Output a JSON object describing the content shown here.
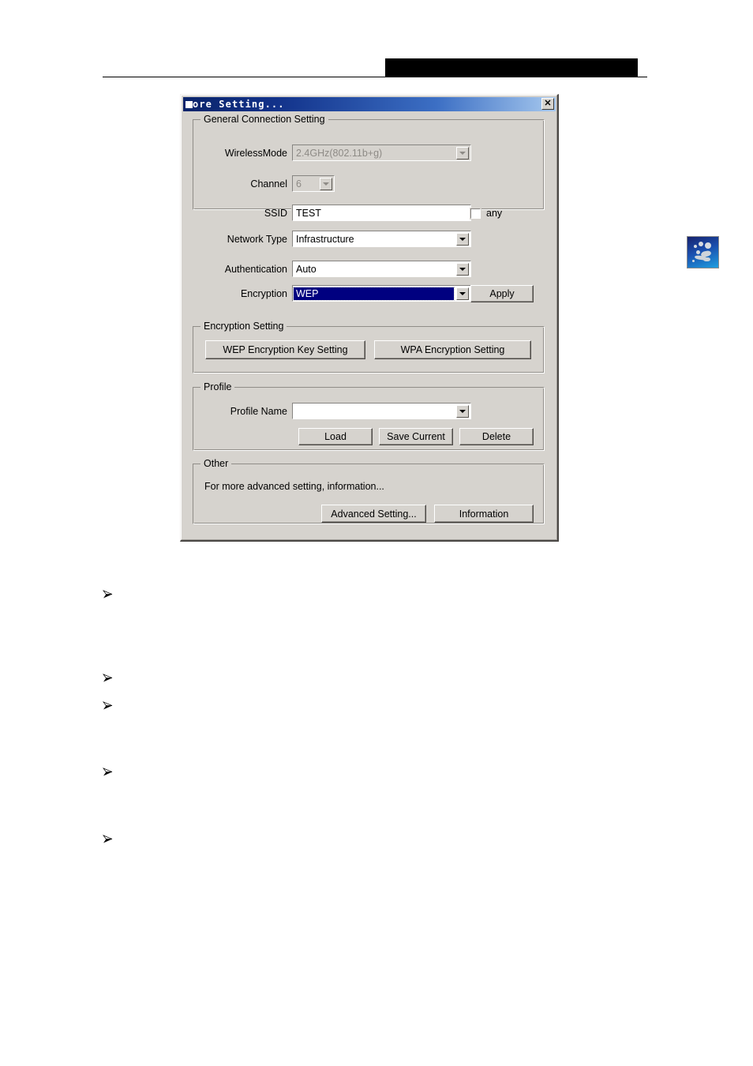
{
  "page": {
    "header": {
      "redaction_color": "#000000",
      "rule_color": "#000000"
    },
    "bullets": [
      {
        "glyph": "➢",
        "label": ""
      },
      {
        "glyph": "➢",
        "label": ""
      },
      {
        "glyph": "➢",
        "label": ""
      },
      {
        "glyph": "➢",
        "label": ""
      },
      {
        "glyph": "➢",
        "label": ""
      }
    ]
  },
  "dialog": {
    "title": "ore Setting...",
    "title_full": "More Setting...",
    "close_label": "✕",
    "titlebar_color": "#0a246a",
    "face_color": "#d6d3ce",
    "groups": {
      "general": {
        "legend": "General Connection Setting",
        "fields": {
          "wireless_mode": {
            "label": "WirelessMode",
            "value": "2.4GHz(802.11b+g)",
            "state": "disabled"
          },
          "channel": {
            "label": "Channel",
            "value": "6",
            "state": "disabled"
          },
          "ssid": {
            "label": "SSID",
            "value": "TEST",
            "state": "enabled"
          },
          "any": {
            "label": "any",
            "checked": false
          },
          "network_type": {
            "label": "Network Type",
            "value": "Infrastructure",
            "state": "enabled"
          },
          "authentication": {
            "label": "Authentication",
            "value": "Auto",
            "state": "enabled"
          },
          "encryption": {
            "label": "Encryption",
            "value": "WEP",
            "state": "selected",
            "highlight_color": "#000080"
          }
        },
        "apply_label": "Apply"
      },
      "encryption_setting": {
        "legend": "Encryption Setting",
        "wep_button": "WEP Encryption Key Setting",
        "wpa_button": "WPA Encryption Setting"
      },
      "profile": {
        "legend": "Profile",
        "profile_name_label": "Profile Name",
        "profile_name_value": "",
        "load_button": "Load",
        "save_button": "Save Current",
        "delete_button": "Delete"
      },
      "other": {
        "legend": "Other",
        "description": "For more advanced setting, information...",
        "advanced_button": "Advanced Setting...",
        "information_button": "Information"
      }
    }
  }
}
